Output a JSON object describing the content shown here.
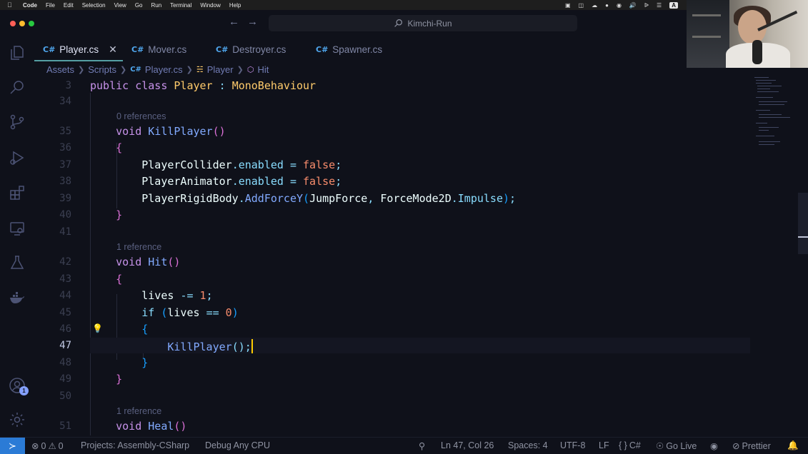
{
  "menubar": {
    "app": "Code",
    "items": [
      "File",
      "Edit",
      "Selection",
      "View",
      "Go",
      "Run",
      "Terminal",
      "Window",
      "Help"
    ],
    "keyboard_indicator": "A"
  },
  "titlebar": {
    "search_text": "Kimchi-Run"
  },
  "tabs": [
    {
      "label": "Player.cs",
      "active": true
    },
    {
      "label": "Mover.cs"
    },
    {
      "label": "Destroyer.cs"
    },
    {
      "label": "Spawner.cs"
    }
  ],
  "tab_icon_text": "C#",
  "breadcrumb": [
    "Assets",
    "Scripts",
    "Player.cs",
    "Player",
    "Hit"
  ],
  "editor": {
    "lines": [
      {
        "n": "3",
        "text": "public class Player : MonoBehaviour"
      },
      {
        "n": "34",
        "text": ""
      },
      {
        "lens": "0 references"
      },
      {
        "n": "35",
        "text": "void KillPlayer()"
      },
      {
        "n": "36",
        "text": "{"
      },
      {
        "n": "37",
        "text": "PlayerCollider.enabled = false;"
      },
      {
        "n": "38",
        "text": "PlayerAnimator.enabled = false;"
      },
      {
        "n": "39",
        "text": "PlayerRigidBody.AddForceY(JumpForce, ForceMode2D.Impulse);"
      },
      {
        "n": "40",
        "text": "}"
      },
      {
        "n": "41",
        "text": ""
      },
      {
        "lens": "1 reference"
      },
      {
        "n": "42",
        "text": "void Hit()"
      },
      {
        "n": "43",
        "text": "{"
      },
      {
        "n": "44",
        "text": "lives -= 1;"
      },
      {
        "n": "45",
        "text": "if (lives == 0)"
      },
      {
        "n": "46",
        "text": "{"
      },
      {
        "n": "47",
        "text": "KillPlayer();",
        "current": true
      },
      {
        "n": "48",
        "text": "}"
      },
      {
        "n": "49",
        "text": "}"
      },
      {
        "n": "50",
        "text": ""
      },
      {
        "lens": "1 reference"
      },
      {
        "n": "51",
        "text": "void Heal()"
      }
    ]
  },
  "statusbar": {
    "errors": "0",
    "warnings": "0",
    "project": "Projects: Assembly-CSharp",
    "debug": "Debug Any CPU",
    "position": "Ln 47, Col 26",
    "spaces": "Spaces: 4",
    "encoding": "UTF-8",
    "eol": "LF",
    "language": "C#",
    "go_live": "Go Live",
    "prettier": "Prettier"
  },
  "activity_badge": "1",
  "colors": {
    "background": "#0f111a",
    "accent": "#84ffff",
    "keyword": "#c792ea",
    "function": "#82aaff",
    "number": "#f78c6c",
    "type": "#ffcb6b"
  }
}
